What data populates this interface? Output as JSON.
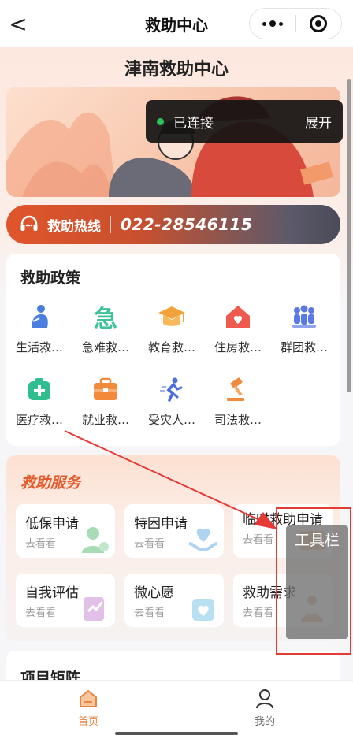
{
  "nav": {
    "back": "<",
    "title": "救助中心"
  },
  "header": {
    "center_title": "津南救助中心"
  },
  "connection": {
    "status": "已连接",
    "action": "展开"
  },
  "hotline": {
    "label": "救助热线",
    "number": "022-28546115"
  },
  "policy": {
    "title": "救助政策",
    "items": [
      {
        "label": "生活救…",
        "icon": "person-sit-icon",
        "color": "#4a7ee0"
      },
      {
        "label": "急难救…",
        "icon": "urgent-char-icon",
        "color": "#3fc29a"
      },
      {
        "label": "教育救…",
        "icon": "grad-cap-icon",
        "color": "#f2a23c"
      },
      {
        "label": "住房救…",
        "icon": "house-heart-icon",
        "color": "#ef5a4e"
      },
      {
        "label": "群团救…",
        "icon": "group-icon",
        "color": "#5a78e6"
      },
      {
        "label": "医疗救…",
        "icon": "medical-kit-icon",
        "color": "#2fbf8e"
      },
      {
        "label": "就业救…",
        "icon": "briefcase-icon",
        "color": "#f28a3c"
      },
      {
        "label": "受灾人…",
        "icon": "running-person-icon",
        "color": "#4a6ee0"
      },
      {
        "label": "司法救…",
        "icon": "gavel-icon",
        "color": "#f08a3c"
      }
    ]
  },
  "service": {
    "title": "救助服务",
    "items": [
      {
        "title": "低保申请",
        "sub": "去看看"
      },
      {
        "title": "特困申请",
        "sub": "去看看"
      },
      {
        "title": "临时救助申请",
        "sub": "去看看"
      },
      {
        "title": "自我评估",
        "sub": "去看看"
      },
      {
        "title": "微心愿",
        "sub": "去看看"
      },
      {
        "title": "救助需求",
        "sub": "去看看"
      }
    ]
  },
  "matrix": {
    "title": "项目矩阵"
  },
  "tabbar": {
    "home": "首页",
    "mine": "我的"
  },
  "overlay": {
    "toolbar_label": "工具栏"
  }
}
